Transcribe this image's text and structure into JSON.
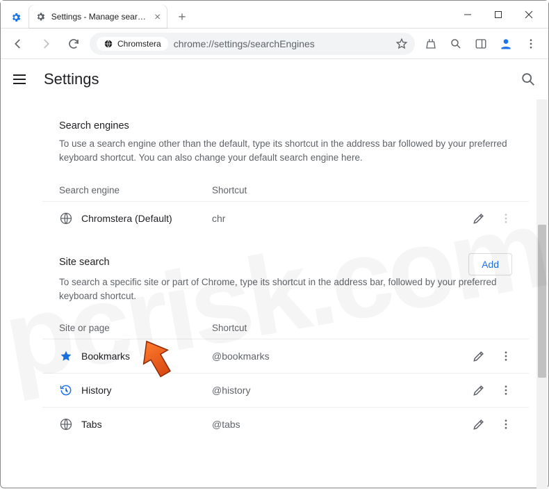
{
  "window": {
    "tab_title": "Settings - Manage search engi"
  },
  "toolbar": {
    "chip_label": "Chromstera",
    "url": "chrome://settings/searchEngines"
  },
  "settings": {
    "title": "Settings"
  },
  "search_engines": {
    "section_title": "Search engines",
    "description": "To use a search engine other than the default, type its shortcut in the address bar followed by your preferred keyboard shortcut. You can also change your default search engine here.",
    "col_engine": "Search engine",
    "col_shortcut": "Shortcut",
    "rows": [
      {
        "icon": "globe",
        "name": "Chromstera (Default)",
        "shortcut": "chr",
        "editable": true,
        "kebab_enabled": false
      }
    ]
  },
  "site_search": {
    "section_title": "Site search",
    "description": "To search a specific site or part of Chrome, type its shortcut in the address bar, followed by your preferred keyboard shortcut.",
    "add_label": "Add",
    "col_engine": "Site or page",
    "col_shortcut": "Shortcut",
    "rows": [
      {
        "icon": "star",
        "name": "Bookmarks",
        "shortcut": "@bookmarks"
      },
      {
        "icon": "history",
        "name": "History",
        "shortcut": "@history"
      },
      {
        "icon": "globe",
        "name": "Tabs",
        "shortcut": "@tabs"
      }
    ]
  },
  "watermark": "pcrisk.com"
}
